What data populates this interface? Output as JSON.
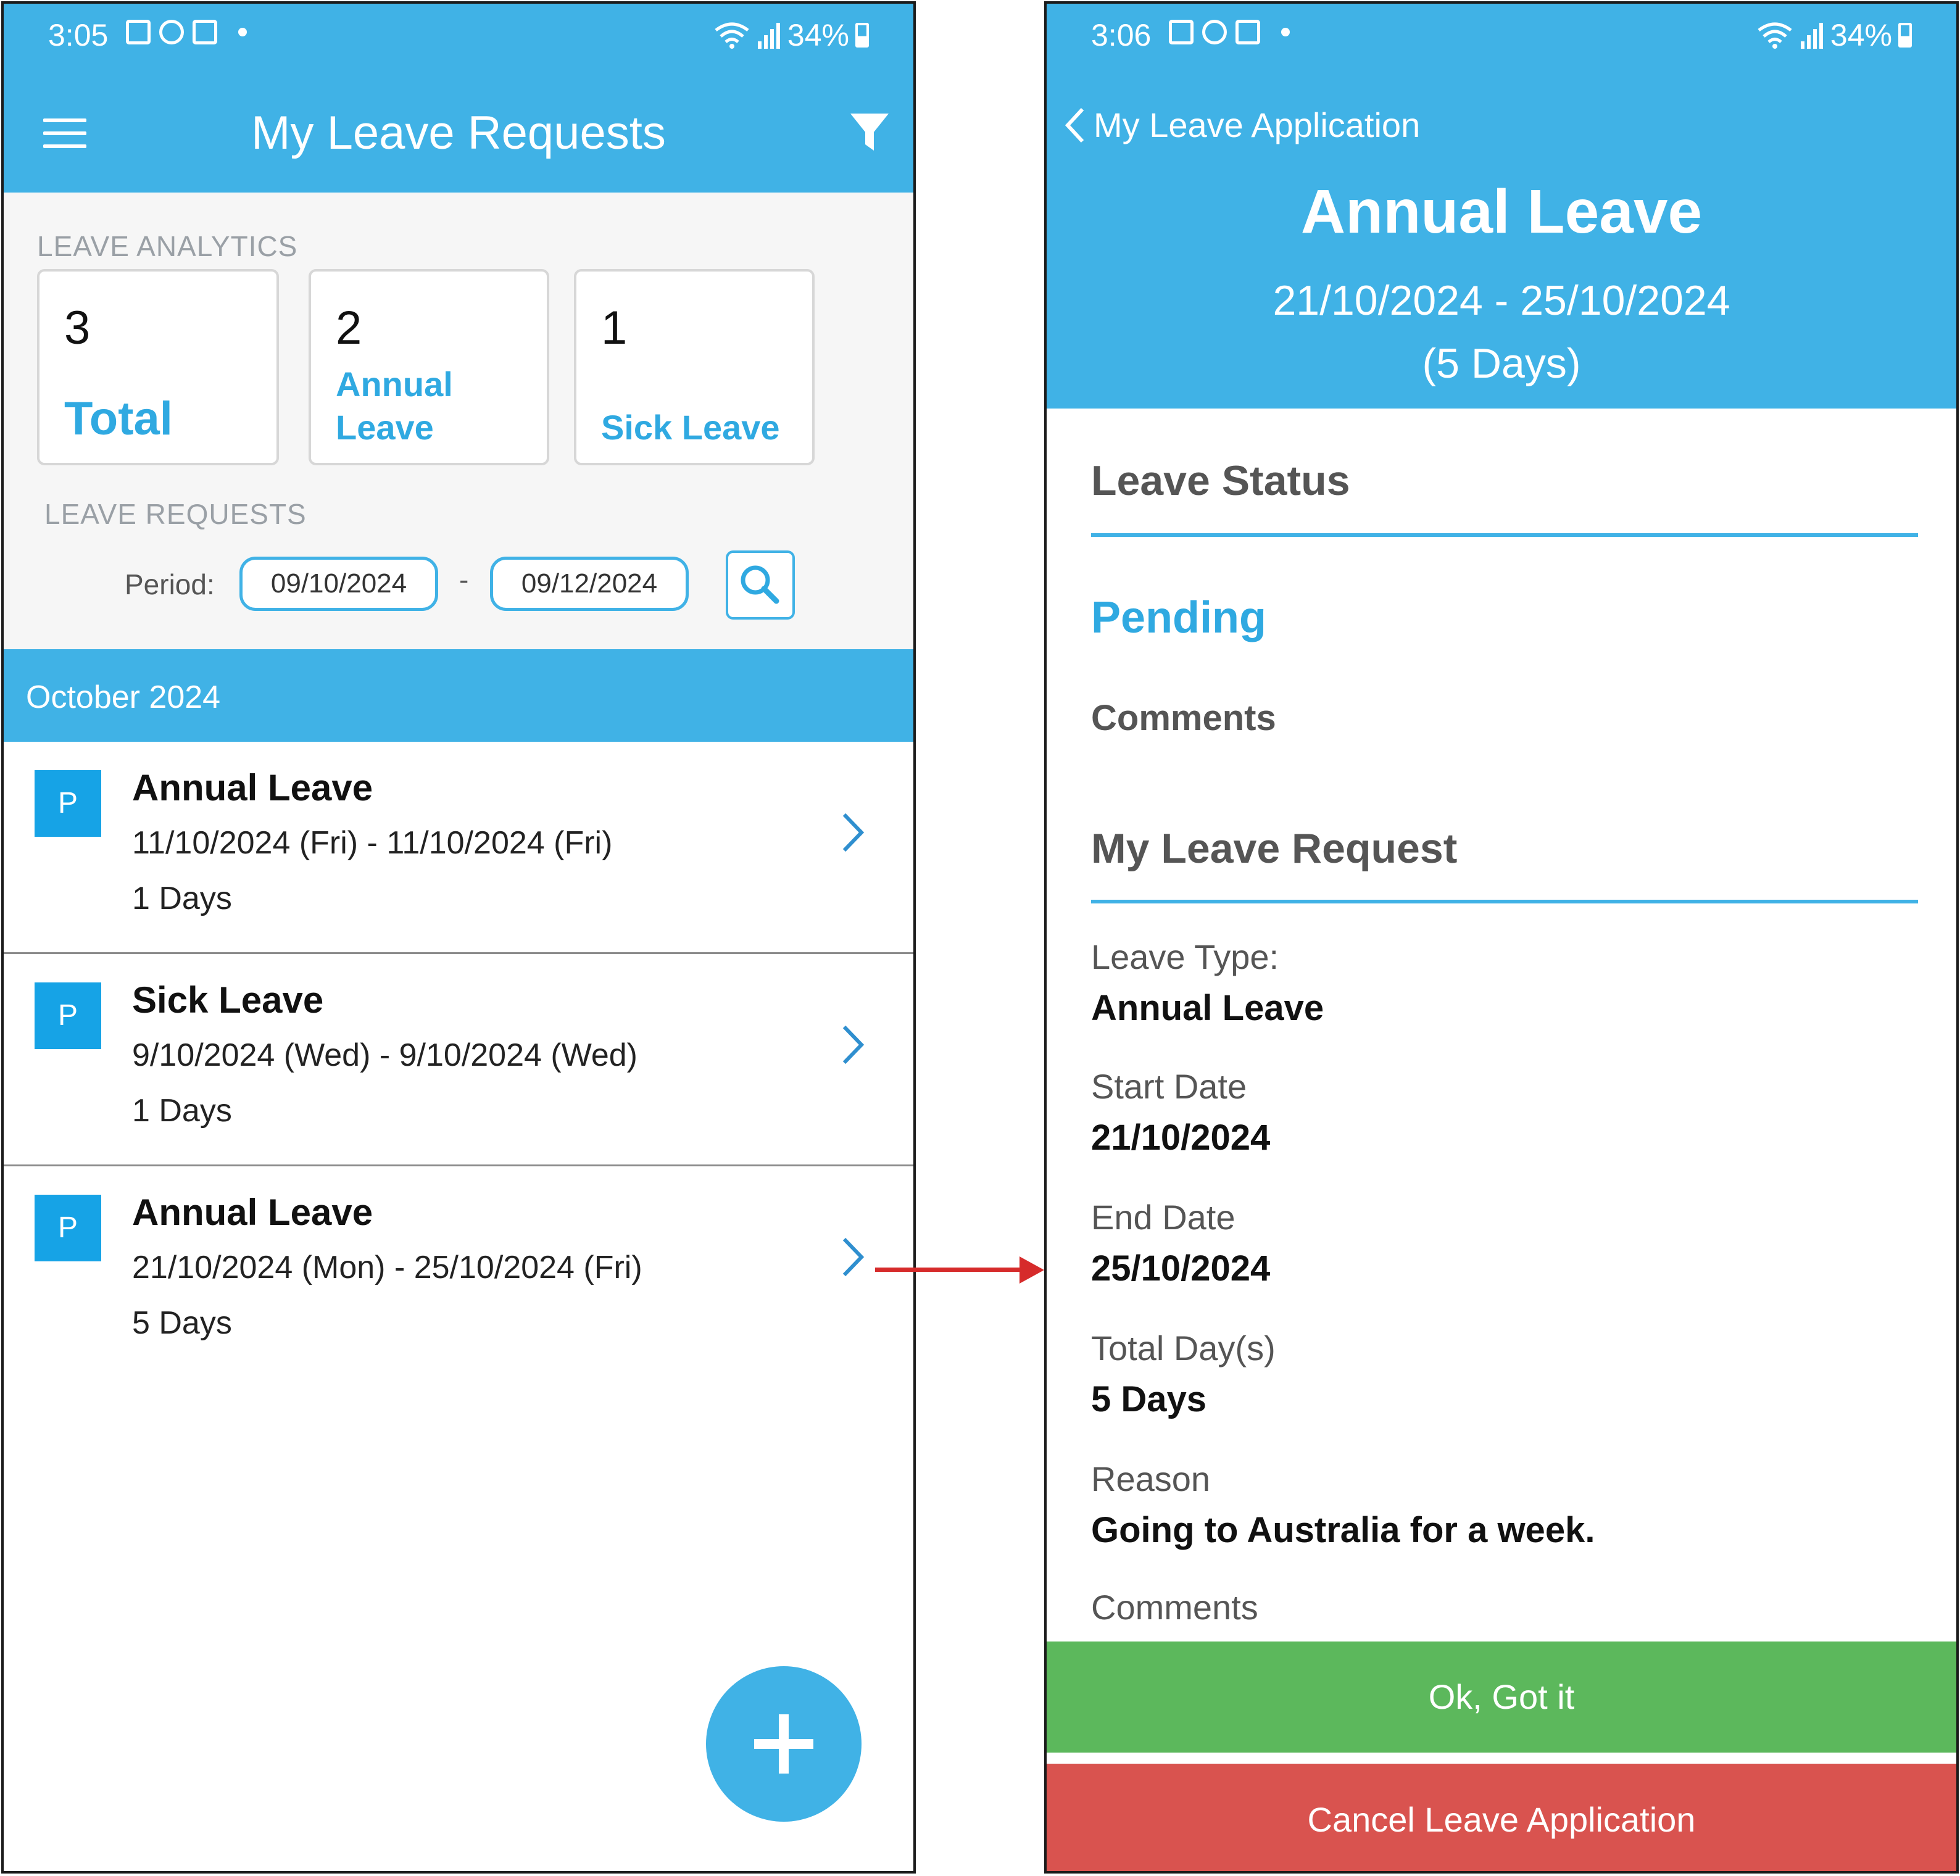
{
  "left_screen": {
    "status_bar": {
      "time": "3:05",
      "battery": "34%"
    },
    "header": {
      "title": "My Leave Requests"
    },
    "analytics": {
      "section_label": "LEAVE ANALYTICS",
      "cards": [
        {
          "count": "3",
          "label": "Total"
        },
        {
          "count": "2",
          "label_line1": "Annual",
          "label_line2": "Leave"
        },
        {
          "count": "1",
          "label": "Sick Leave"
        }
      ]
    },
    "requests_filter": {
      "section_label": "LEAVE REQUESTS",
      "period_label": "Period:",
      "start_date": "09/10/2024",
      "separator": "-",
      "end_date": "09/12/2024"
    },
    "month": "October 2024",
    "requests": [
      {
        "badge": "P",
        "title": "Annual Leave",
        "dates": "11/10/2024 (Fri) - 11/10/2024 (Fri)",
        "days": "1 Days"
      },
      {
        "badge": "P",
        "title": "Sick Leave",
        "dates": "9/10/2024 (Wed) - 9/10/2024 (Wed)",
        "days": "1 Days"
      },
      {
        "badge": "P",
        "title": "Annual Leave",
        "dates": "21/10/2024 (Mon) - 25/10/2024 (Fri)",
        "days": "5 Days"
      }
    ]
  },
  "right_screen": {
    "status_bar": {
      "time": "3:06",
      "battery": "34%"
    },
    "header": {
      "back_label": "My Leave Application",
      "title": "Annual Leave",
      "range": "21/10/2024 - 25/10/2024",
      "duration": "(5 Days)"
    },
    "leave_status": {
      "heading": "Leave Status",
      "status": "Pending",
      "comments_label": "Comments"
    },
    "request": {
      "heading": "My Leave Request",
      "fields": [
        {
          "label": "Leave Type:",
          "value": "Annual Leave"
        },
        {
          "label": "Start Date",
          "value": "21/10/2024"
        },
        {
          "label": "End Date",
          "value": "25/10/2024"
        },
        {
          "label": "Total Day(s)",
          "value": "5 Days"
        },
        {
          "label": "Reason",
          "value": "Going to Australia for a week."
        }
      ],
      "comments_label": "Comments"
    },
    "buttons": {
      "ok": "Ok, Got it",
      "cancel": "Cancel Leave Application"
    }
  },
  "colors": {
    "primary": "#40b2e6",
    "accent_text": "#2fa9e1",
    "badge": "#16a3e6",
    "ok_button": "#5cb85c",
    "cancel_button": "#d9534f",
    "arrow": "#d62b2b"
  }
}
